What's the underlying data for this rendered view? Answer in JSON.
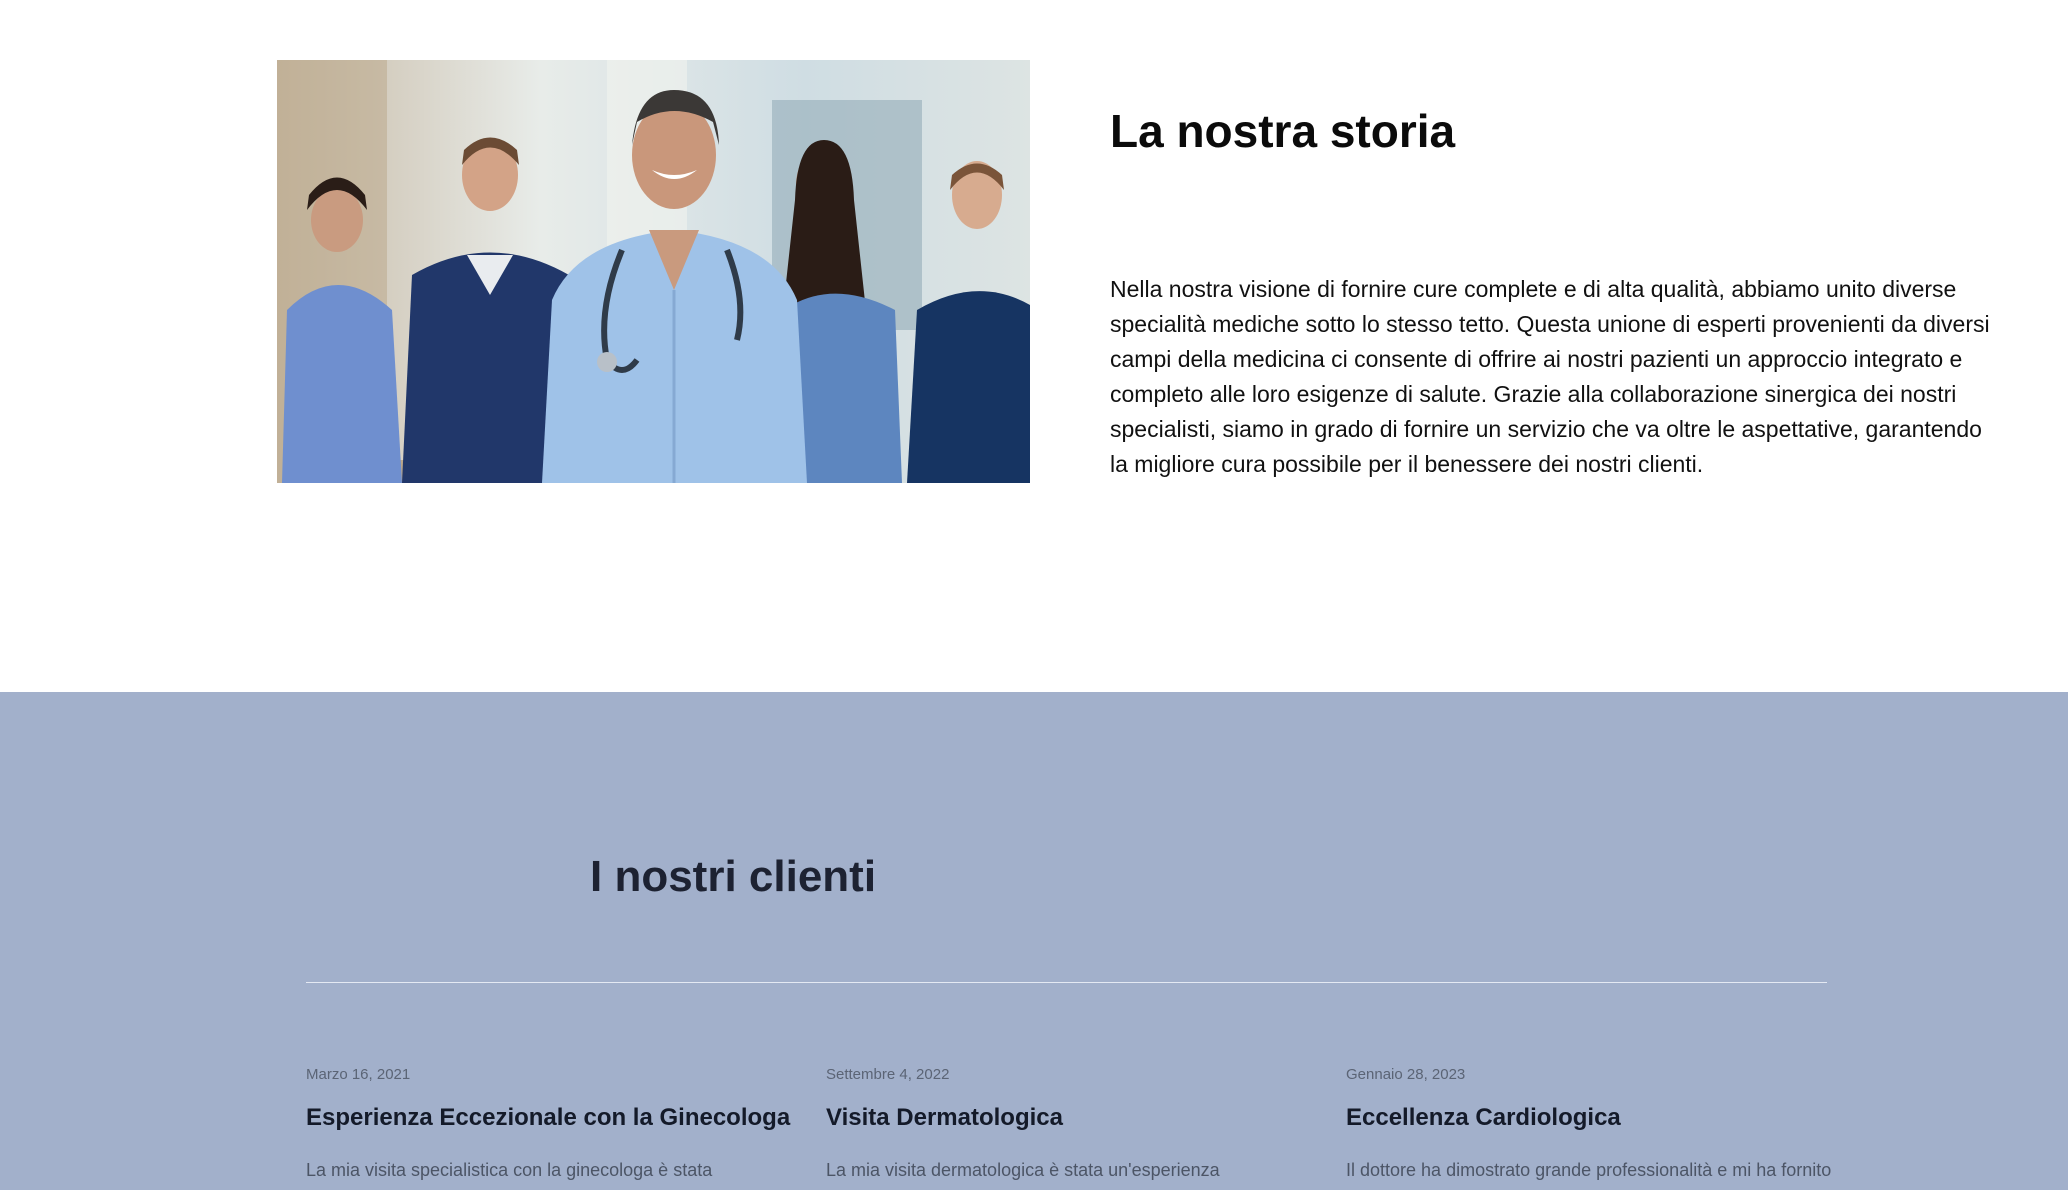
{
  "about": {
    "image_alt": "Team of medical professionals",
    "title": "La nostra storia",
    "text": "Nella nostra visione di fornire cure complete e di alta qualità, abbiamo unito diverse specialità mediche sotto lo stesso tetto. Questa unione di esperti provenienti da diversi campi della medicina ci consente di offrire ai nostri pazienti un approccio integrato e completo alle loro esigenze di salute. Grazie alla collaborazione sinergica dei nostri specialisti, siamo in grado di fornire un servizio che va oltre le aspettative, garantendo la migliore cura possibile per il benessere dei nostri clienti."
  },
  "clients": {
    "title": "I nostri clienti",
    "background_color": "#a2b0cb",
    "reviews": [
      {
        "date": "Marzo 16, 2021",
        "title": "Esperienza Eccezionale con la Ginecologa",
        "text": "La mia visita specialistica con la ginecologa è stata"
      },
      {
        "date": "Settembre 4, 2022",
        "title": "Visita Dermatologica",
        "text": "La mia visita dermatologica è stata un'esperienza"
      },
      {
        "date": "Gennaio 28, 2023",
        "title": "Eccellenza Cardiologica",
        "text": "Il dottore ha dimostrato grande professionalità e mi ha fornito"
      }
    ]
  }
}
